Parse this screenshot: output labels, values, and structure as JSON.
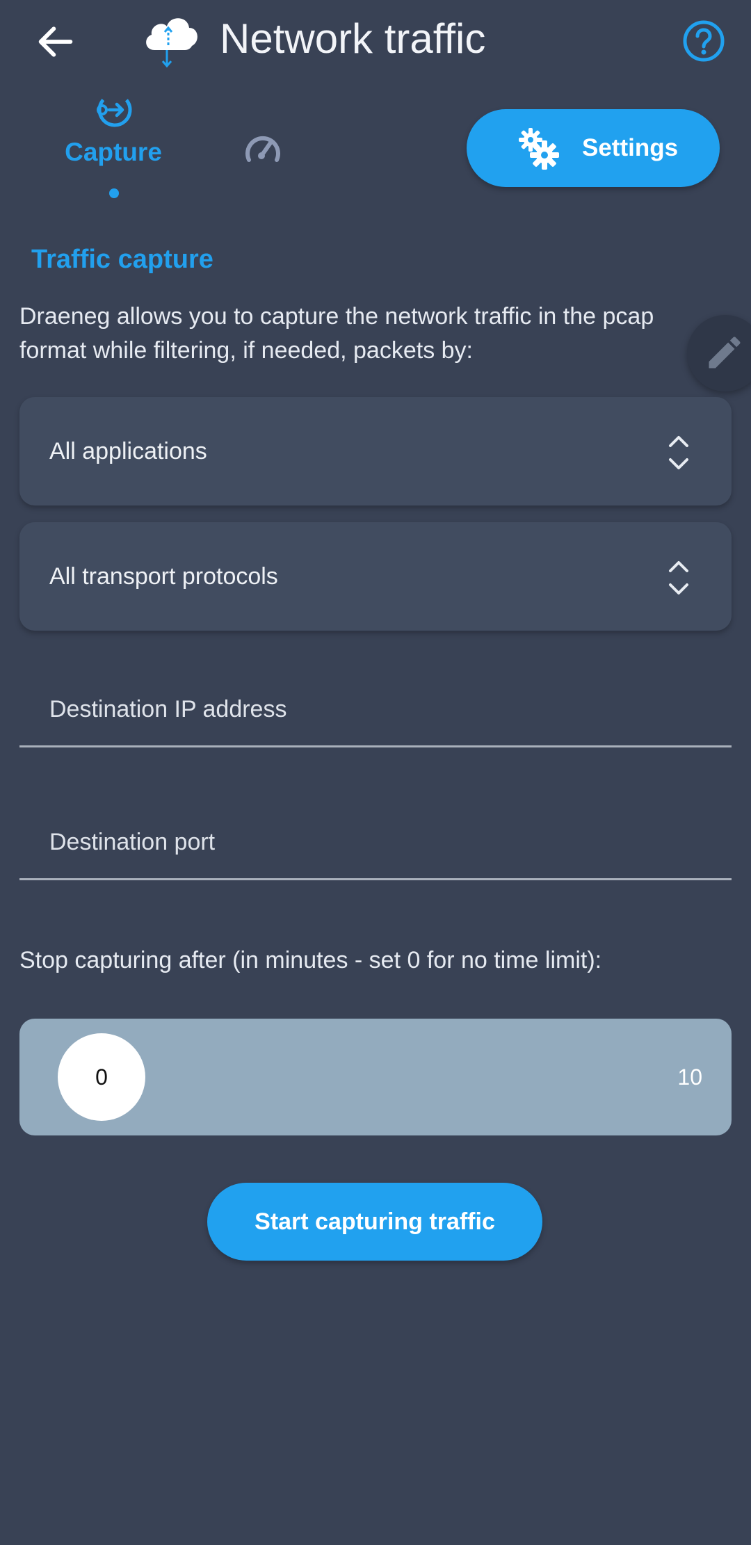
{
  "header": {
    "title": "Network traffic",
    "back_icon": "arrow-left-icon",
    "logo_icon": "cloud-transfer-icon",
    "help_icon": "help-circle-icon"
  },
  "tabs": [
    {
      "label": "Capture",
      "icon": "capture-icon",
      "selected": true
    },
    {
      "label": "",
      "icon": "speedometer-icon",
      "selected": false
    }
  ],
  "settings_button": {
    "label": "Settings",
    "icon": "gears-icon"
  },
  "section": {
    "title": "Traffic capture",
    "description": "Draeneg allows you to capture the network traffic in the pcap format while filtering, if needed, packets by:"
  },
  "filters": {
    "application_select": {
      "value": "All applications"
    },
    "protocol_select": {
      "value": "All transport protocols"
    },
    "destination_ip": {
      "placeholder": "Destination IP address",
      "value": ""
    },
    "destination_port": {
      "placeholder": "Destination port",
      "value": ""
    }
  },
  "timer": {
    "label": "Stop capturing after (in minutes - set 0 for no time limit):",
    "value": "0",
    "max": "10"
  },
  "start_button": {
    "label": "Start capturing traffic"
  },
  "colors": {
    "accent": "#21a1ef",
    "background": "#394255",
    "card": "#414c60",
    "slider": "#93abbe"
  }
}
